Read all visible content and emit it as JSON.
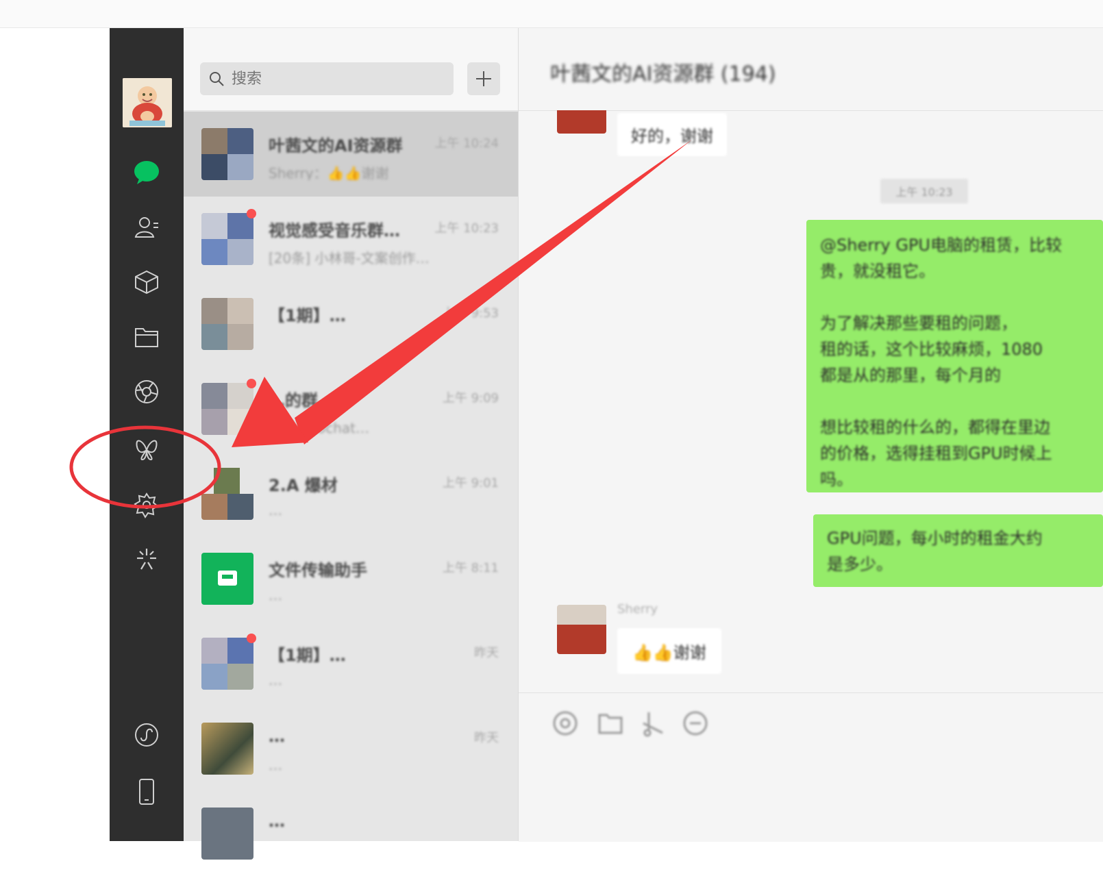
{
  "search": {
    "placeholder": "搜索"
  },
  "rail": {
    "icons": [
      "chat-icon",
      "contacts-icon",
      "favorites-icon",
      "files-icon",
      "moments-icon",
      "channels-icon",
      "search-explore-icon",
      "mini-programs-icon",
      "settings-circle-icon",
      "phone-icon"
    ],
    "active_color": "#07c160"
  },
  "chats": [
    {
      "name": "叶茜文的AI资源群",
      "time": "上午 10:24",
      "preview": "Sherry：👍👍谢谢"
    },
    {
      "name": "视觉感受音乐群…",
      "time": "上午 10:23",
      "preview": "[20条] 小林哥-文案创作…"
    },
    {
      "name": "【1期】…",
      "time": "上午 9:53",
      "preview": ""
    },
    {
      "name": "…的群",
      "time": "上午 9:09",
      "preview": "…管你cochat…"
    },
    {
      "name": "2.A 爆材",
      "time": "上午 9:01",
      "preview": "…"
    },
    {
      "name": "文件传输助手",
      "time": "上午 8:11",
      "preview": "…"
    },
    {
      "name": "【1期】…",
      "time": "昨天",
      "preview": "…"
    },
    {
      "name": "…",
      "time": "昨天",
      "preview": "…"
    },
    {
      "name": "…",
      "time": "",
      "preview": ""
    }
  ],
  "conversation": {
    "title": "叶茜文的AI资源群 (194)",
    "msg_1": "好的，谢谢",
    "time_chip": "上午 10:23",
    "green_1_lines": [
      "@Sherry GPU电脑的租赁，比较",
      "贵，就没租它。",
      "",
      "为了解决那些要租的问题，",
      "租的话，这个比较麻烦，1080",
      "都是从的那里，每个月的",
      "",
      "想比较租的什么的，都得在里边",
      "的价格，选得挂租到GPU时候上",
      "吗。"
    ],
    "green_2_lines": [
      "GPU问题，每小时的租金大约",
      "是多少。"
    ],
    "sender_name": "Sherry",
    "msg_2": "👍👍谢谢"
  },
  "annotation_colors": {
    "arrow": "#f23c3c",
    "circle": "#e8343a"
  }
}
